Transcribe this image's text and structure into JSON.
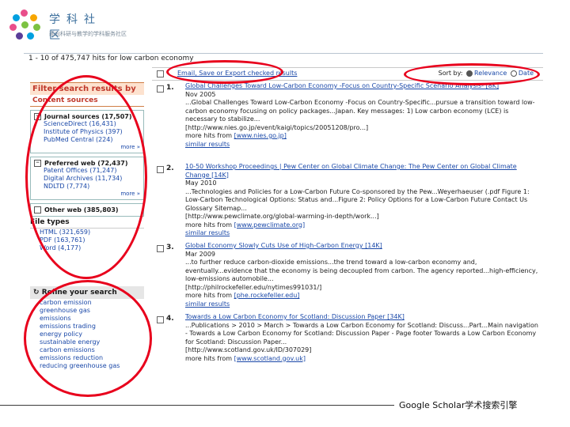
{
  "logo": {
    "title": "学科社区",
    "subtitle": "面向科研与教学的学科服务社区"
  },
  "hits_text": "1 - 10 of 475,747 hits for low carbon economy",
  "toolbar": {
    "email_label": "Email, Save or Export checked results",
    "sort_label": "Sort by:",
    "sort_options": [
      "Relevance",
      "Date"
    ],
    "selected": "Relevance"
  },
  "sidebar": {
    "filter_title": "Filter search results by",
    "content_sources": "Content sources",
    "journal_sources": "Journal sources (17,507)",
    "journal_items": [
      "ScienceDirect (16,431)",
      "Institute of Physics (397)",
      "PubMed Central (224)"
    ],
    "preferred_web": "Preferred web (72,437)",
    "preferred_items": [
      "Patent Offices (71,247)",
      "Digital Archives (11,734)",
      "NDLTD (7,774)"
    ],
    "other_web": "Other web (385,803)",
    "more_label": "more »",
    "file_types": "File types",
    "file_items": [
      "HTML (321,659)",
      "PDF (163,761)",
      "Word (4,177)"
    ]
  },
  "refine": {
    "title": "Refine your search",
    "items": [
      "carbon emission",
      "greenhouse gas",
      "emissions",
      "emissions trading",
      "energy policy",
      "sustainable energy",
      "carbon emissions",
      "emissions reduction",
      "reducing greenhouse gas"
    ]
  },
  "results": [
    {
      "num": "1.",
      "title": "Global Challenges Toward Low-Carbon Economy -Focus on Country-Specific Scenario Analysis- [8K]",
      "date": "Nov 2005",
      "snippet": "...Global Challenges Toward Low-Carbon Economy -Focus on Country-Specific...pursue a transition toward low-carbon economy focusing on policy packages...Japan. Key messages: 1) Low carbon economy (LCE) is necessary to stabilize...",
      "url": "[http://www.nies.go.jp/event/kaigi/topics/20051208/pro...]",
      "more_hits": "more hits from",
      "more_link": "[www.nies.go.jp]",
      "similar": "similar results"
    },
    {
      "num": "2.",
      "title": "10-50 Workshop Proceedings | Pew Center on Global Climate Change: The Pew Center on Global Climate Change [14K]",
      "date": "May 2010",
      "snippet": "...Technologies and Policies for a Low-Carbon Future Co-sponsored by the Pew...Weyerhaeuser (.pdf Figure 1: Low-Carbon Technological Options: Status and...Figure 2: Policy Options for a Low-Carbon Future Contact Us Glossary Sitemap...",
      "url": "[http://www.pewclimate.org/global-warming-in-depth/work...]",
      "more_hits": "more hits from",
      "more_link": "[www.pewclimate.org]",
      "similar": "similar results"
    },
    {
      "num": "3.",
      "title": "Global Economy Slowly Cuts Use of High-Carbon Energy [14K]",
      "date": "Mar 2009",
      "snippet": "...to further reduce carbon-dioxide emissions...the trend toward a low-carbon economy and, eventually...evidence that the economy is being decoupled from carbon. The agency reported...high-efficiency, low-emissions automobile...",
      "url": "[http://philrockefeller.edu/nytimes991031/]",
      "more_hits": "more hits from",
      "more_link": "[phe.rockefeller.edu]",
      "similar": "similar results"
    },
    {
      "num": "4.",
      "title": "Towards a Low Carbon Economy for Scotland: Discussion Paper [34K]",
      "date": "",
      "snippet": "...Publications > 2010 > March > Towards a Low Carbon Economy for Scotland: Discuss...Part...Main navigation - Towards a Low Carbon Economy for Scotland: Discussion Paper - Page footer Towards a Low Carbon Economy for Scotland: Discussion Paper...",
      "url": "[http://www.scotland.gov.uk/ID/307029]",
      "more_hits": "more hits from",
      "more_link": "[www.scotland.gov.uk]",
      "similar": ""
    }
  ],
  "highlight_color": "#e8001c",
  "footer_text": "Google Scholar学术搜索引擎"
}
